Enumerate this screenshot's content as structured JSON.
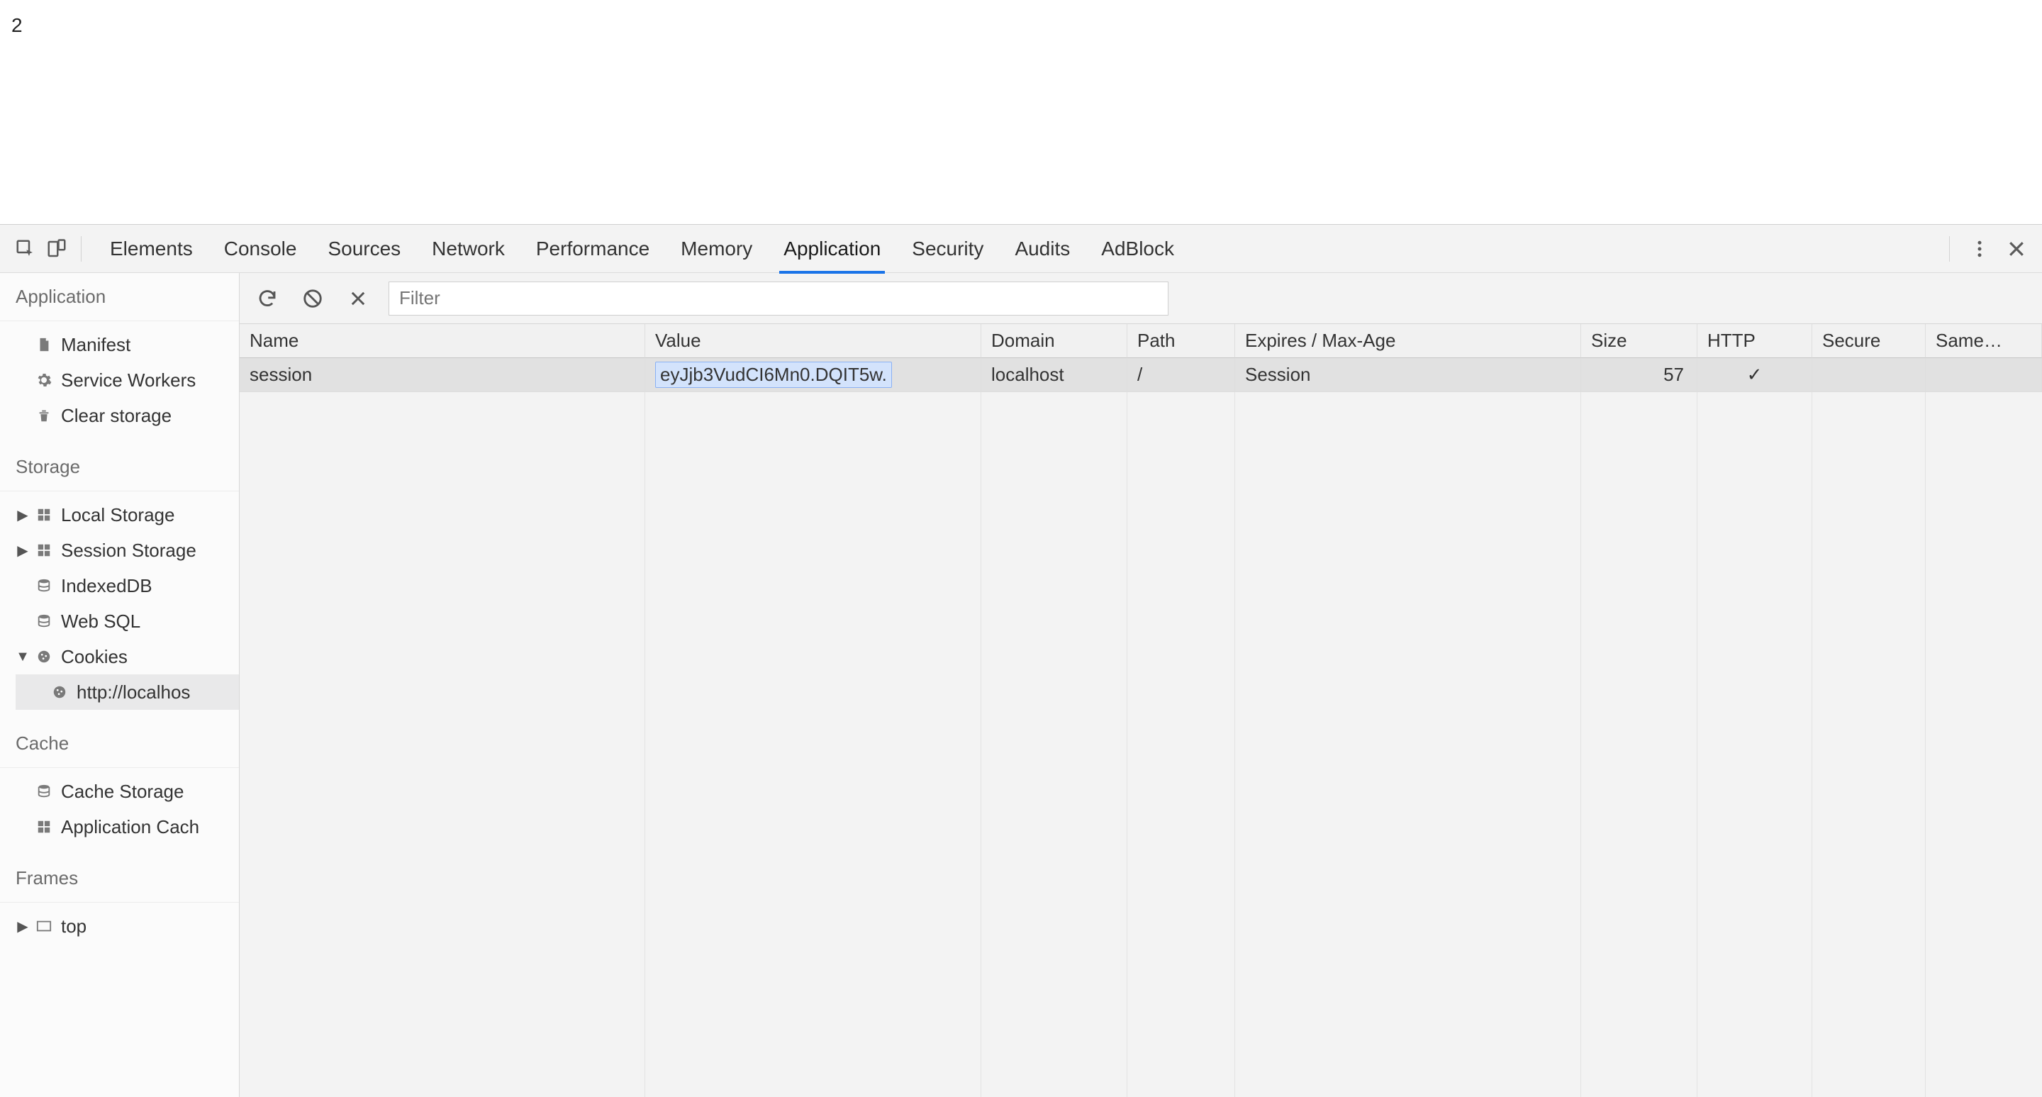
{
  "page_top_text": "2",
  "tabs": [
    "Elements",
    "Console",
    "Sources",
    "Network",
    "Performance",
    "Memory",
    "Application",
    "Security",
    "Audits",
    "AdBlock"
  ],
  "active_tab": "Application",
  "toolbar": {
    "filter_placeholder": "Filter"
  },
  "sidebar": {
    "sections": [
      {
        "title": "Application",
        "items": [
          {
            "label": "Manifest",
            "icon": "file"
          },
          {
            "label": "Service Workers",
            "icon": "gear"
          },
          {
            "label": "Clear storage",
            "icon": "trash"
          }
        ]
      },
      {
        "title": "Storage",
        "items": [
          {
            "label": "Local Storage",
            "icon": "grid-4",
            "expandable": true,
            "expanded": false
          },
          {
            "label": "Session Storage",
            "icon": "grid-4",
            "expandable": true,
            "expanded": false
          },
          {
            "label": "IndexedDB",
            "icon": "db"
          },
          {
            "label": "Web SQL",
            "icon": "db"
          },
          {
            "label": "Cookies",
            "icon": "cookie",
            "expandable": true,
            "expanded": true,
            "children": [
              {
                "label": "http://localhos",
                "icon": "cookie",
                "selected": true
              }
            ]
          }
        ]
      },
      {
        "title": "Cache",
        "items": [
          {
            "label": "Cache Storage",
            "icon": "db"
          },
          {
            "label": "Application Cach",
            "icon": "grid-4"
          }
        ]
      },
      {
        "title": "Frames",
        "items": [
          {
            "label": "top",
            "icon": "frame",
            "expandable": true,
            "expanded": false
          }
        ]
      }
    ]
  },
  "columns": [
    "Name",
    "Value",
    "Domain",
    "Path",
    "Expires / Max-Age",
    "Size",
    "HTTP",
    "Secure",
    "Same…"
  ],
  "rows": [
    {
      "name": "session",
      "value": "eyJjb3VudCI6Mn0.DQIT5w.",
      "domain": "localhost",
      "path": "/",
      "expires": "Session",
      "size": "57",
      "http": "✓",
      "secure": "",
      "same": "",
      "editing_value": true
    }
  ]
}
